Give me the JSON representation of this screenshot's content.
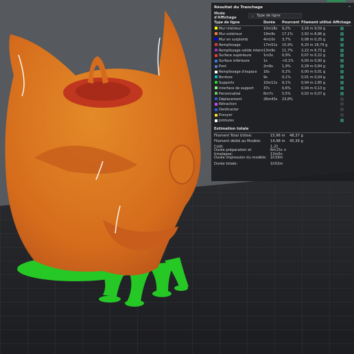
{
  "panel": {
    "title": "Résultat du Tranchage",
    "collapse_icon": "chevron-up-icon",
    "mode_label": "Mode d'Affichage",
    "mode_value": "Type de ligne",
    "columns": [
      "Type de ligne",
      "Durée",
      "Pourcent",
      "Filament utilisé",
      "Affichage"
    ],
    "rows": [
      {
        "color": "#ffff00",
        "name": "Mur intérieur",
        "time": "10m18s",
        "pct": "9,2%",
        "len": "3,16 m",
        "weight": "9,59 g",
        "show": true
      },
      {
        "color": "#ff7d38",
        "name": "Mur extérieur",
        "time": "19m9s",
        "pct": "17,1%",
        "len": "2,92 m",
        "weight": "8,86 g",
        "show": true
      },
      {
        "color": "#0000ff",
        "name": "Mur en surplomb",
        "time": "4m10s",
        "pct": "3,7%",
        "len": "0,08 m",
        "weight": "0,25 g",
        "show": true
      },
      {
        "color": "#d73e3e",
        "name": "Remplissage",
        "time": "17m51s",
        "pct": "15,9%",
        "len": "6,20 m",
        "weight": "18,79 g",
        "show": true
      },
      {
        "color": "#9b36c9",
        "name": "Remplissage solide interne",
        "time": "13m9s",
        "pct": "11,7%",
        "len": "2,22 m",
        "weight": "6,73 g",
        "show": true
      },
      {
        "color": "#f03a3a",
        "name": "Surface supérieure",
        "time": "1m3s",
        "pct": "0,9%",
        "len": "0,07 m",
        "weight": "0,22 g",
        "show": true
      },
      {
        "color": "#3a7dd8",
        "name": "Surface inférieure",
        "time": "1s",
        "pct": "<0,1%",
        "len": "0,00 m",
        "weight": "0,00 g",
        "show": true
      },
      {
        "color": "#5b79c9",
        "name": "Pont",
        "time": "2m9s",
        "pct": "1,9%",
        "len": "0,28 m",
        "weight": "0,84 g",
        "show": true
      },
      {
        "color": "#ffffff",
        "name": "Remplissage d'espace",
        "time": "16s",
        "pct": "0,2%",
        "len": "0,00 m",
        "weight": "0,01 g",
        "show": true
      },
      {
        "color": "#00c0c0",
        "name": "Bordure",
        "time": "9s",
        "pct": "0,1%",
        "len": "0,01 m",
        "weight": "0,04 g",
        "show": true
      },
      {
        "color": "#2ad42a",
        "name": "Supports",
        "time": "10m11s",
        "pct": "9,1%",
        "len": "0,94 m",
        "weight": "2,85 g",
        "show": true
      },
      {
        "color": "#8ef08e",
        "name": "Interface de support",
        "time": "37s",
        "pct": "0,6%",
        "len": "0,04 m",
        "weight": "0,13 g",
        "show": true
      },
      {
        "color": "#6cc46c",
        "name": "Personnalisé",
        "time": "6m7s",
        "pct": "5,5%",
        "len": "0,02 m",
        "weight": "0,07 g",
        "show": true
      },
      {
        "color": "#2b58d0",
        "name": "Déplacement",
        "time": "26m43s",
        "pct": "23,8%",
        "len": "",
        "weight": "",
        "show": false
      },
      {
        "color": "#c050f0",
        "name": "Rétraction",
        "time": "",
        "pct": "",
        "len": "",
        "weight": "",
        "show": false
      },
      {
        "color": "#2b5ce8",
        "name": "Derétracter",
        "time": "",
        "pct": "",
        "len": "",
        "weight": "",
        "show": false
      },
      {
        "color": "#f0e030",
        "name": "Essuyer",
        "time": "",
        "pct": "",
        "len": "",
        "weight": "",
        "show": false
      },
      {
        "color": "#ffffff",
        "name": "Jointures",
        "time": "",
        "pct": "",
        "len": "",
        "weight": "",
        "show": true
      }
    ],
    "summary_title": "Estimation totale",
    "summary": [
      {
        "k": "Filament Total Utilisé:",
        "v1": "15,96 m",
        "v2": "48,37 g"
      },
      {
        "k": "Filament dédié au Modèle:",
        "v1": "14,98 m",
        "v2": "45,39 g"
      },
      {
        "k": "Coût:",
        "v1": "1,21",
        "v2": ""
      },
      {
        "k": "Durée préparation et timelapse:",
        "v1": "6m15s + 13m5s",
        "v2": ""
      },
      {
        "k": "Durée impression du modèle:",
        "v1": "1h33m",
        "v2": ""
      },
      {
        "k": "Durée totale:",
        "v1": "1h52m",
        "v2": ""
      }
    ]
  },
  "colors": {
    "checkbox_on": "#2f7a63",
    "model_orange": "#e0761f",
    "support_green": "#2ad42a"
  }
}
